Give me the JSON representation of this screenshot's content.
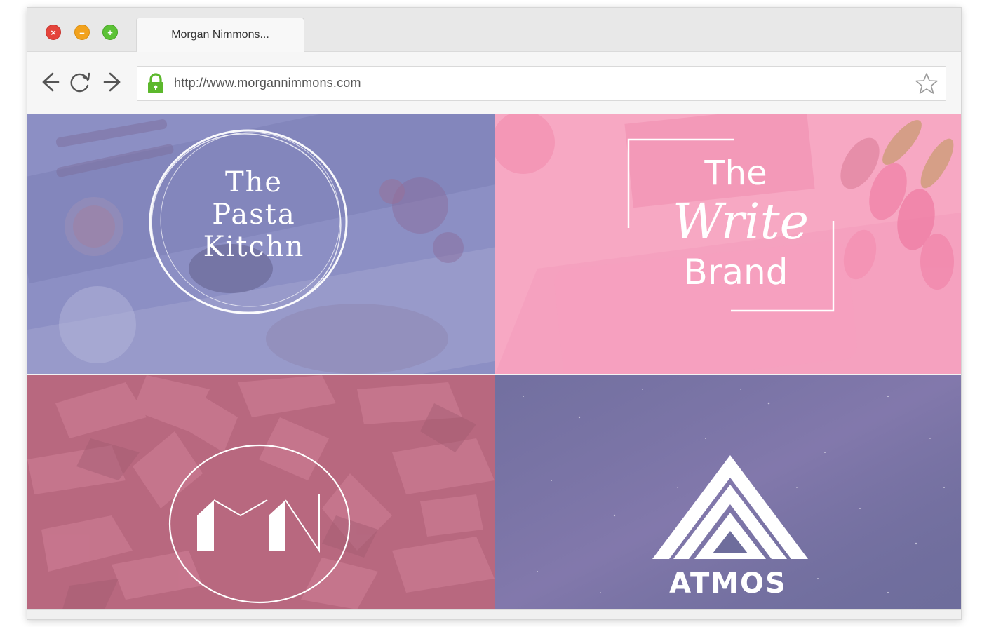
{
  "browser": {
    "tab_title": "Morgan Nimmons...",
    "url": "http://www.morgannimmons.com",
    "window_controls": [
      "close-icon",
      "minimize-icon",
      "maximize-icon"
    ],
    "nav_icons": [
      "back-arrow-icon",
      "reload-icon",
      "forward-arrow-icon"
    ],
    "secure_icon": "lock-icon",
    "bookmark_icon": "star-icon"
  },
  "portfolio": {
    "tiles": [
      {
        "name": "The Pasta Kitchn",
        "lines": [
          "The",
          "Pasta",
          "Kitchn"
        ],
        "color": "#8c8fc4"
      },
      {
        "name": "The Write Brand",
        "the": "The",
        "script": "Write",
        "brand": "Brand",
        "color": "#f7a8c3"
      },
      {
        "name": "MN",
        "monogram": "MN",
        "color": "#b8687f"
      },
      {
        "name": "ATMOS",
        "label": "ATMOS",
        "color": "#6e6d9c"
      }
    ]
  },
  "colors": {
    "close": "#e4443b",
    "minimize": "#f2a21d",
    "maximize": "#5cc236",
    "lock": "#5cb82c"
  }
}
